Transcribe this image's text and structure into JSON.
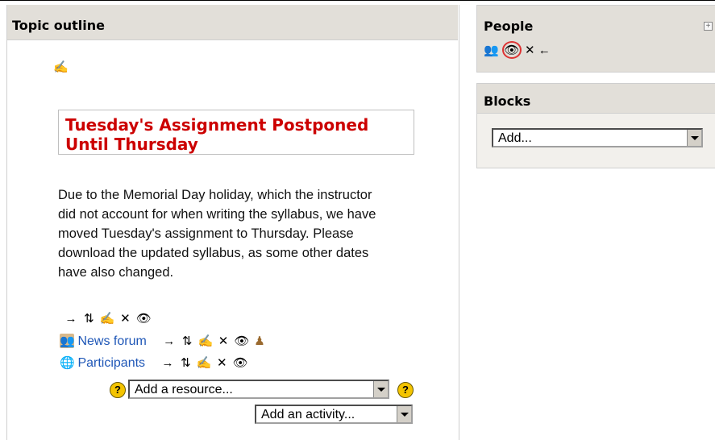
{
  "main": {
    "title": "Topic outline",
    "topic_heading": "Tuesday's Assignment Postponed Until Thursday",
    "paragraph": "Due to the Memorial Day holiday, which the instructor did not account for when writing the syllabus, we have moved Tuesday's assignment to Thursday. Please download the updated syllabus, as some other dates have also changed.",
    "items": [
      {
        "label": "News forum"
      },
      {
        "label": "Participants"
      }
    ],
    "add_resource": "Add a resource...",
    "add_activity": "Add an activity..."
  },
  "side": {
    "people_title": "People",
    "blocks_title": "Blocks",
    "blocks_add": "Add..."
  },
  "icons": {
    "edit": "edit-icon",
    "move": "move-right-icon",
    "sort": "move-updown-icon",
    "delete": "delete-icon",
    "hide": "hide-eye-icon",
    "forum": "forum-icon",
    "participants": "participants-icon",
    "help": "help-icon"
  }
}
